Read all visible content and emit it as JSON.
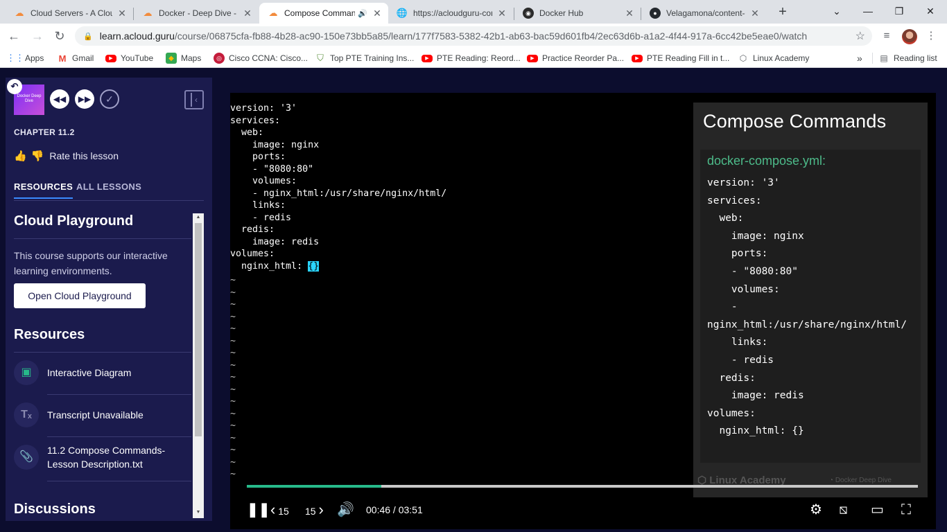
{
  "tabs": [
    {
      "title": "Cloud Servers - A Cloud Guru",
      "icon": "acloudguru-icon",
      "active": false
    },
    {
      "title": "Docker - Deep Dive - A Cloud Guru",
      "icon": "acloudguru-icon",
      "active": false
    },
    {
      "title": "Compose Commands",
      "icon": "acloudguru-icon",
      "active": true,
      "audio": true
    },
    {
      "title": "https://acloudguru-content",
      "icon": "globe-icon",
      "active": false
    },
    {
      "title": "Docker Hub",
      "icon": "dockerhub-icon",
      "active": false
    },
    {
      "title": "Velagamona/content-docker",
      "icon": "github-icon",
      "active": false
    }
  ],
  "address": {
    "host": "learn.acloud.guru",
    "path": "/course/06875cfa-fb88-4b28-ac90-150e73bb5a85/learn/177f7583-5382-42b1-ab63-bac59d601fb4/2ec63d6b-a1a2-4f44-917a-6cc42be5eae0/watch"
  },
  "bookmarks": [
    {
      "label": "Apps",
      "icon": "apps-grid-icon"
    },
    {
      "label": "Gmail",
      "icon": "gmail-icon"
    },
    {
      "label": "YouTube",
      "icon": "youtube-icon"
    },
    {
      "label": "Maps",
      "icon": "maps-icon"
    },
    {
      "label": "Cisco CCNA: Cisco...",
      "icon": "cisco-icon"
    },
    {
      "label": "Top PTE Training Ins...",
      "icon": "pte-icon"
    },
    {
      "label": "PTE Reading: Reord...",
      "icon": "youtube-icon"
    },
    {
      "label": "Practice Reorder Pa...",
      "icon": "youtube-icon"
    },
    {
      "label": "PTE Reading Fill in t...",
      "icon": "youtube-icon"
    },
    {
      "label": "Linux Academy",
      "icon": "linux-academy-icon"
    }
  ],
  "bookmarks_overflow": "»",
  "reading_list": "Reading list",
  "sidebar": {
    "thumb_text": "Docker Deep Dive",
    "chapter": "CHAPTER 11.2",
    "rate_label": "Rate this lesson",
    "tabs": [
      {
        "label": "RESOURCES",
        "active": true
      },
      {
        "label": "ALL LESSONS",
        "active": false
      }
    ],
    "playground": {
      "title": "Cloud Playground",
      "description": "This course supports our interactive learning environments.",
      "button": "Open Cloud Playground"
    },
    "resources_title": "Resources",
    "resources": [
      {
        "label": "Interactive Diagram",
        "icon": "image-icon"
      },
      {
        "label": "Transcript Unavailable",
        "icon": "transcript-off-icon"
      },
      {
        "label": "11.2 Compose Commands-Lesson Description.txt",
        "icon": "paperclip-icon"
      }
    ],
    "discussions_title": "Discussions"
  },
  "video": {
    "terminal_lines": "version: '3'\nservices:\n  web:\n    image: nginx\n    ports:\n    - \"8080:80\"\n    volumes:\n    - nginx_html:/usr/share/nginx/html/\n    links:\n    - redis\n  redis:\n    image: redis\nvolumes:\n  nginx_html: ",
    "cursor_text": "{}",
    "tilde_lines": "~\n~\n~\n~\n~\n~\n~\n~\n~\n~\n~\n~\n~\n~\n~\n~\n~",
    "slide_title": "Compose Commands",
    "slide_file": "docker-compose.yml:",
    "slide_code": "version: '3'\nservices:\n  web:\n    image: nginx\n    ports:\n    - \"8080:80\"\n    volumes:\n    -\nnginx_html:/usr/share/nginx/html/\n    links:\n    - redis\n  redis:\n    image: redis\nvolumes:\n  nginx_html: {}",
    "watermark_left": "Linux Academy",
    "watermark_right": "Docker Deep Dive",
    "progress_fraction": 0.2,
    "skip_back": "15",
    "skip_forward": "15",
    "time": "00:46 / 03:51"
  },
  "colors": {
    "progress": "#27ba8a",
    "sidebar_bg": "#1b1b4d",
    "page_bg": "#0c0d2e",
    "tab_underline": "#3a8bff"
  }
}
